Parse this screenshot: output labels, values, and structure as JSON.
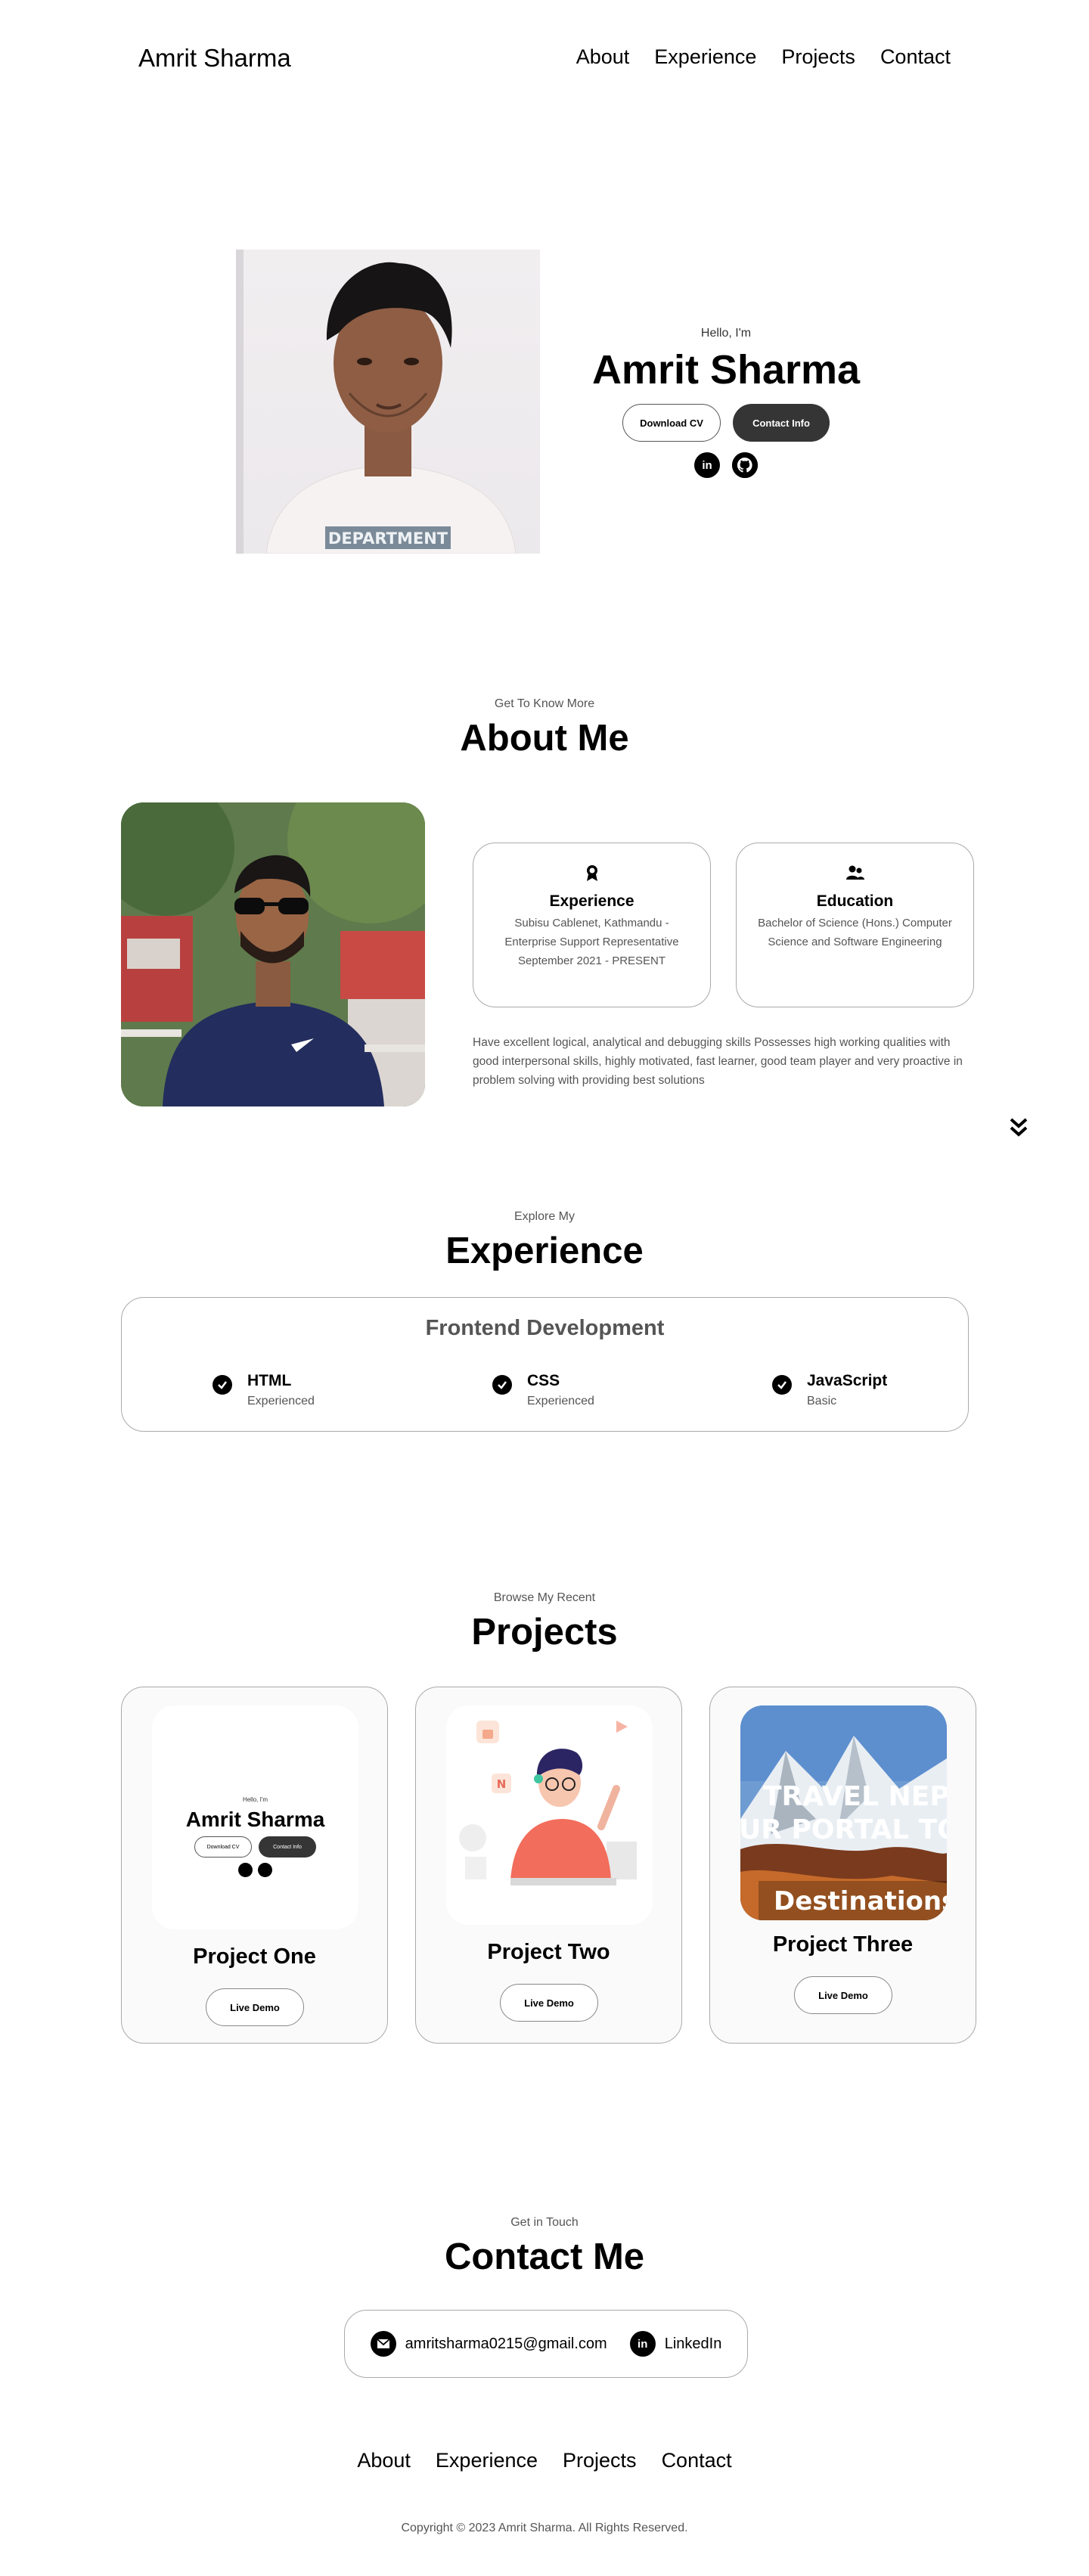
{
  "nav": {
    "logo": "Amrit Sharma",
    "links": [
      "About",
      "Experience",
      "Projects",
      "Contact"
    ]
  },
  "hero": {
    "greeting": "Hello, I'm",
    "name": "Amrit Sharma",
    "download_cv": "Download CV",
    "contact_info": "Contact Info",
    "photo_shirt_text": "DEPARTMENT"
  },
  "about": {
    "subtitle": "Get To Know More",
    "title": "About Me",
    "experience_card": {
      "title": "Experience",
      "text": "Subisu Cablenet, Kathmandu - Enterprise Support Representative September 2021 - PRESENT"
    },
    "education_card": {
      "title": "Education",
      "text": "Bachelor of Science (Hons.) Computer Science and Software Engineering"
    },
    "paragraph": "Have excellent logical, analytical and debugging skills Possesses high working qualities with good interpersonal skills, highly motivated, fast learner, good team player and very proactive in problem solving with providing best solutions"
  },
  "experience": {
    "subtitle": "Explore My",
    "title": "Experience",
    "box_title": "Frontend Development",
    "skills": [
      {
        "name": "HTML",
        "level": "Experienced"
      },
      {
        "name": "CSS",
        "level": "Experienced"
      },
      {
        "name": "JavaScript",
        "level": "Basic"
      }
    ]
  },
  "projects": {
    "subtitle": "Browse My Recent",
    "title": "Projects",
    "items": [
      {
        "title": "Project One",
        "button": "Live Demo"
      },
      {
        "title": "Project Two",
        "button": "Live Demo"
      },
      {
        "title": "Project Three",
        "button": "Live Demo"
      }
    ],
    "preview_one": {
      "greeting": "Hello, I'm",
      "name": "Amrit Sharma",
      "download_cv": "Download CV",
      "contact_info": "Contact Info"
    },
    "preview_three": {
      "line1": "TRAVEL NEPAL",
      "line2": "UR PORTAL TO N",
      "caption": "Destinations"
    }
  },
  "contact": {
    "subtitle": "Get in Touch",
    "title": "Contact Me",
    "email": "amritsharma0215@gmail.com",
    "linkedin": "LinkedIn"
  },
  "footer": {
    "links": [
      "About",
      "Experience",
      "Projects",
      "Contact"
    ],
    "copyright": "Copyright © 2023 Amrit Sharma. All Rights Reserved."
  },
  "colors": {
    "dark_button": "#353535",
    "muted_text": "#555555",
    "border": "#aaaaaa"
  }
}
